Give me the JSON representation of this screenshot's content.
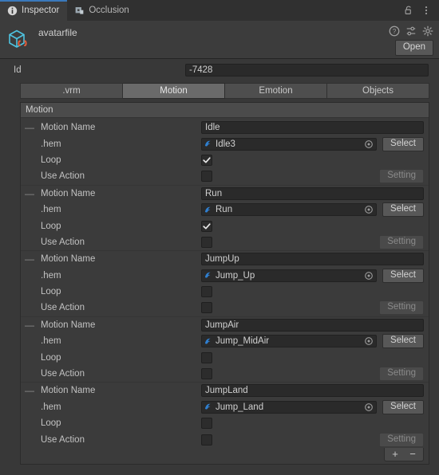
{
  "window": {
    "tabs": [
      {
        "label": "Inspector",
        "icon": "info-icon",
        "active": true
      },
      {
        "label": "Occlusion",
        "icon": "occlusion-icon",
        "active": false
      }
    ],
    "lock_icon": "lock-icon",
    "menu_icon": "kebab-menu-icon"
  },
  "asset": {
    "name": "avatarfile",
    "icon": "scriptable-object-icon",
    "help_icon": "help-icon",
    "preset_icon": "preset-icon",
    "settings_icon": "gear-icon",
    "open_label": "Open"
  },
  "id_row": {
    "label": "Id",
    "value": "-7428"
  },
  "inner_tabs": [
    {
      "label": ".vrm",
      "selected": false
    },
    {
      "label": "Motion",
      "selected": true
    },
    {
      "label": "Emotion",
      "selected": false
    },
    {
      "label": "Objects",
      "selected": false
    }
  ],
  "list": {
    "header": "Motion",
    "labels": {
      "motion_name": "Motion Name",
      "hem": ".hem",
      "loop": "Loop",
      "use_action": "Use Action",
      "select": "Select",
      "setting": "Setting"
    },
    "items": [
      {
        "motion_name": "Idle",
        "hem": "Idle3",
        "loop": true,
        "use_action": false
      },
      {
        "motion_name": "Run",
        "hem": "Run",
        "loop": true,
        "use_action": false
      },
      {
        "motion_name": "JumpUp",
        "hem": "Jump_Up",
        "loop": false,
        "use_action": false
      },
      {
        "motion_name": "JumpAir",
        "hem": "Jump_MidAir",
        "loop": false,
        "use_action": false
      },
      {
        "motion_name": "JumpLand",
        "hem": "Jump_Land",
        "loop": false,
        "use_action": false
      }
    ],
    "footer": {
      "add_label": "+",
      "remove_label": "−"
    }
  },
  "colors": {
    "accent": "#3a79bb",
    "window_bg": "#383838",
    "panel_bg": "#3c3c3c",
    "field_bg": "#2a2a2a",
    "icon_cyan": "#4ec3e0",
    "icon_orange": "#e8603c"
  }
}
